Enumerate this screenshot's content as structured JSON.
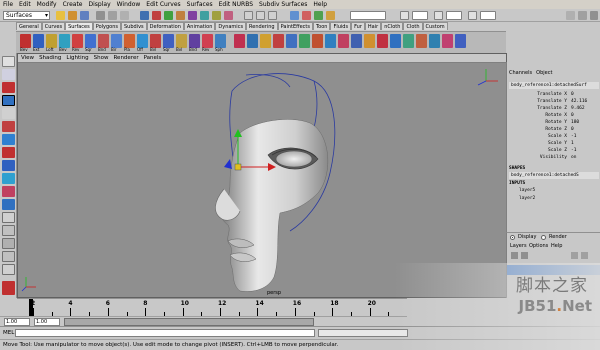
{
  "menubar": {
    "items": [
      "File",
      "Edit",
      "Modify",
      "Create",
      "Display",
      "Window",
      "Edit Curves",
      "Surfaces",
      "Edit NURBS",
      "Subdiv Surfaces",
      "Help"
    ]
  },
  "statusline": {
    "mode": "Surfaces"
  },
  "shelf": {
    "tabs": [
      "General",
      "Curves",
      "Surfaces",
      "Polygons",
      "Subdivs",
      "Deformation",
      "Animation",
      "Dynamics",
      "Rendering",
      "PaintEffects",
      "Toon",
      "Fluids",
      "Fur",
      "Hair",
      "nCloth",
      "Cloth",
      "Custom"
    ],
    "active_tab": "Surfaces",
    "icon_labels": [
      "Bev",
      "Ext",
      "Loft",
      "Bev",
      "Rev",
      "Sqr",
      "Bnd",
      "Bir",
      "Pla",
      "Off",
      "Bvl",
      "Sqr",
      "Bvl",
      "Bnd",
      "Rev",
      "Sph"
    ]
  },
  "viewport": {
    "menu": [
      "View",
      "Shading",
      "Lighting",
      "Show",
      "Renderer",
      "Panels"
    ],
    "camera": "persp"
  },
  "channelbox": {
    "tabs": [
      "Channels",
      "Object"
    ],
    "object_name": "body_reference1:detachedSurf",
    "attributes": [
      {
        "name": "Translate X",
        "value": "0"
      },
      {
        "name": "Translate Y",
        "value": "42.116"
      },
      {
        "name": "Translate Z",
        "value": "9.462"
      },
      {
        "name": "Rotate X",
        "value": "0"
      },
      {
        "name": "Rotate Y",
        "value": "180"
      },
      {
        "name": "Rotate Z",
        "value": "0"
      },
      {
        "name": "Scale X",
        "value": "-1"
      },
      {
        "name": "Scale Y",
        "value": "1"
      },
      {
        "name": "Scale Z",
        "value": "-1"
      },
      {
        "name": "Visibility",
        "value": "on"
      }
    ],
    "shapes_header": "SHAPES",
    "shape_name": "body_reference1:detachedS",
    "inputs_header": "INPUTS",
    "inputs": [
      "layer5",
      "layer2"
    ]
  },
  "layers": {
    "display_label": "Display",
    "render_label": "Render",
    "menu": [
      "Layers",
      "Options",
      "Help"
    ]
  },
  "timeline": {
    "ticks": [
      "2",
      "4",
      "6",
      "8",
      "10",
      "12",
      "14",
      "16",
      "18",
      "20"
    ]
  },
  "range": {
    "start": "1.00",
    "current": "1.00"
  },
  "cmdline": {
    "label": "MEL"
  },
  "helpline": {
    "text": "Move Tool: Use manipulator to move object(s). Use edit mode to change pivot (INSERT). Ctrl+LMB to move perpendicular."
  },
  "watermark": {
    "top": "脚本之家",
    "bottom_a": "JB51",
    "bottom_dot": ".",
    "bottom_b": "Net"
  }
}
